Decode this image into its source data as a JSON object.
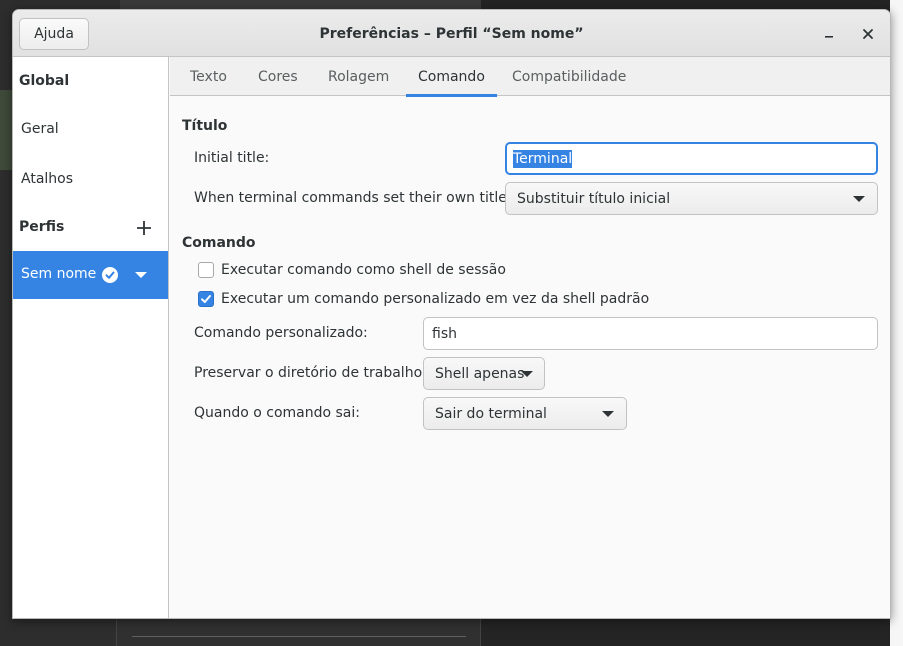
{
  "window": {
    "title": "Preferências – Perfil “Sem nome”",
    "help_label": "Ajuda",
    "minimize_icon": "minimize-icon",
    "close_icon": "close-icon"
  },
  "sidebar": {
    "global_heading": "Global",
    "items": [
      {
        "label": "Geral"
      },
      {
        "label": "Atalhos"
      }
    ],
    "profiles_heading": "Perfis",
    "add_icon": "plus-icon",
    "profiles": [
      {
        "label": "Sem nome",
        "default_icon": "check-circle-icon",
        "menu_icon": "chevron-down-icon",
        "selected": true
      }
    ]
  },
  "tabs": [
    {
      "label": "Texto",
      "active": false
    },
    {
      "label": "Cores",
      "active": false
    },
    {
      "label": "Rolagem",
      "active": false
    },
    {
      "label": "Comando",
      "active": true
    },
    {
      "label": "Compatibilidade",
      "active": false
    }
  ],
  "title_section": {
    "heading": "Título",
    "initial_title_label": "Initial title:",
    "initial_title_value": "Terminal",
    "commands_set_title_label": "When terminal commands set their own titles:",
    "commands_set_title_value": "Substituir título inicial"
  },
  "command_section": {
    "heading": "Comando",
    "login_shell_label": "Executar comando como shell de sessão",
    "login_shell_checked": false,
    "custom_command_toggle_label": "Executar um comando personalizado em vez da shell padrão",
    "custom_command_toggle_checked": true,
    "custom_command_label": "Comando personalizado:",
    "custom_command_value": "fish",
    "preserve_dir_label": "Preservar o diretório de trabalho:",
    "preserve_dir_value": "Shell apenas",
    "on_exit_label": "Quando o comando sai:",
    "on_exit_value": "Sair do terminal"
  },
  "colors": {
    "accent": "#3584e4",
    "headerbar": "#e6e6e6",
    "window_bg": "#fafafa"
  }
}
